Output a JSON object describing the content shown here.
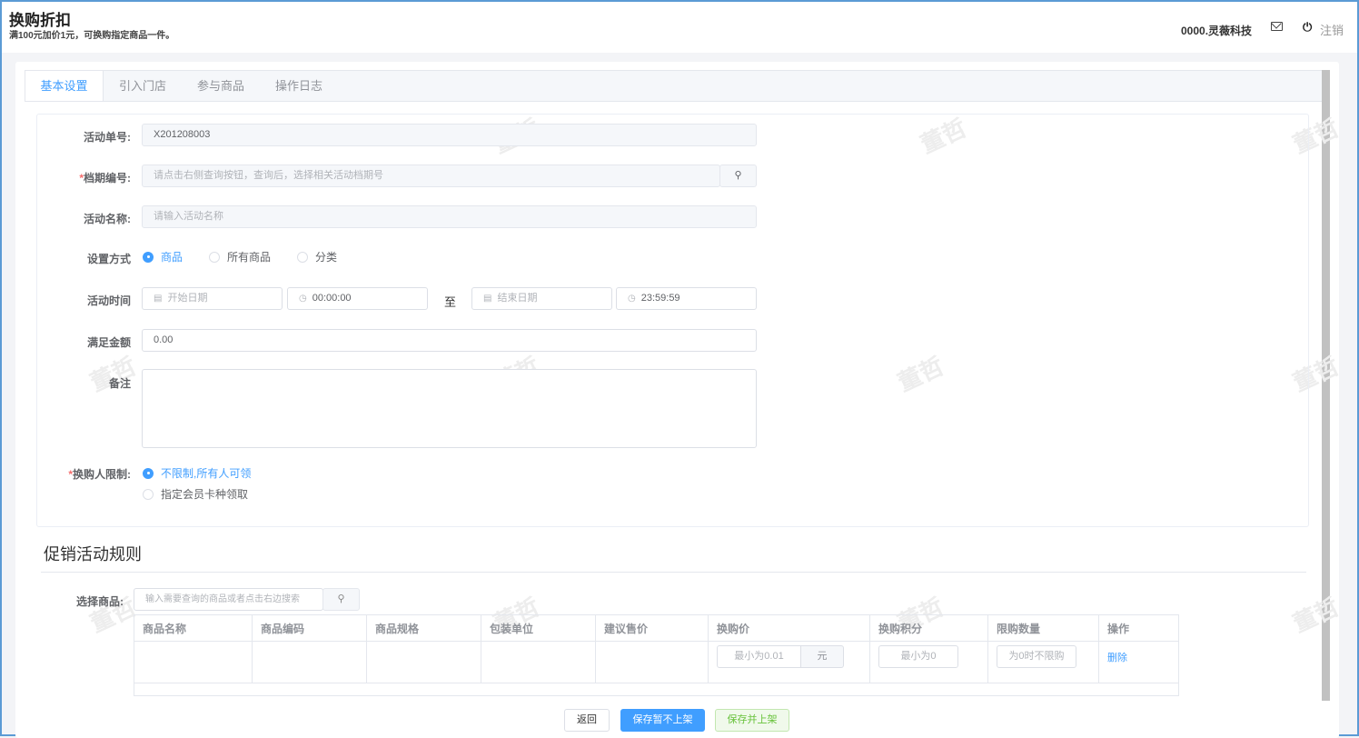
{
  "header": {
    "title": "换购折扣",
    "subtitle": "满100元加价1元，可换购指定商品一件。",
    "company": "0000.灵薇科技",
    "logout": "注销",
    "mail_icon": "mail-icon",
    "power_icon": "power-icon"
  },
  "tabs": [
    {
      "label": "基本设置",
      "active": true
    },
    {
      "label": "引入门店"
    },
    {
      "label": "参与商品"
    },
    {
      "label": "操作日志"
    }
  ],
  "watermark": "董哲",
  "form": {
    "activity_no": {
      "label": "活动单号:",
      "value": "X201208003"
    },
    "period_no": {
      "label": "档期编号:",
      "placeholder": "请点击右侧查询按钮，查询后，选择相关活动档期号"
    },
    "activity_name": {
      "label": "活动名称:",
      "placeholder": "请输入活动名称"
    },
    "set_mode": {
      "label": "设置方式",
      "options": [
        "商品",
        "所有商品",
        "分类"
      ],
      "selected": "商品"
    },
    "activity_time": {
      "label": "活动时间",
      "start_date_placeholder": "开始日期",
      "start_time": "00:00:00",
      "to": "至",
      "end_date_placeholder": "结束日期",
      "end_time": "23:59:59"
    },
    "amount": {
      "label": "满足金额",
      "value": "0.00"
    },
    "remark": {
      "label": "备注",
      "value": ""
    },
    "buyer_limit": {
      "label": "换购人限制:",
      "options": [
        "不限制,所有人可领",
        "指定会员卡种领取"
      ],
      "selected": "不限制,所有人可领"
    }
  },
  "rules": {
    "title": "促销活动规则",
    "select_label": "选择商品:",
    "search_placeholder": "输入需要查询的商品或者点击右边搜索",
    "columns": [
      "商品名称",
      "商品编码",
      "商品规格",
      "包装单位",
      "建议售价",
      "换购价",
      "换购积分",
      "限购数量",
      "操作"
    ],
    "row": {
      "price_placeholder": "最小为0.01",
      "price_unit": "元",
      "points_placeholder": "最小为0",
      "limit_placeholder": "为0时不限购",
      "action": "删除"
    }
  },
  "footer": {
    "back": "返回",
    "save_draft": "保存暂不上架",
    "save_publish": "保存并上架"
  }
}
